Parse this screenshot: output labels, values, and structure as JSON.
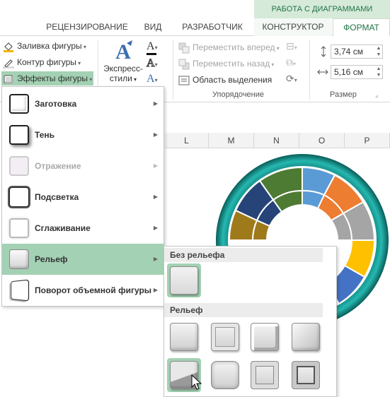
{
  "ribbon": {
    "context_group": "РАБОТА С ДИАГРАММАМИ",
    "tabs": [
      "РЕЦЕНЗИРОВАНИЕ",
      "ВИД",
      "РАЗРАБОТЧИК",
      "КОНСТРУКТОР",
      "ФОРМАТ"
    ],
    "active_tab": "ФОРМАТ",
    "shape_fill": "Заливка фигуры",
    "shape_outline": "Контур фигуры",
    "shape_effects": "Эффекты фигуры",
    "wordart_styles_line1": "Экспресс-",
    "wordart_styles_line2": "стили",
    "bring_forward": "Переместить вперед",
    "send_backward": "Переместить назад",
    "selection_pane": "Область выделения",
    "arrange_group": "Упорядочение",
    "height_value": "3,74 см",
    "width_value": "5,16 см",
    "size_group": "Размер"
  },
  "columns": [
    "L",
    "M",
    "N",
    "O",
    "P"
  ],
  "effects_menu": {
    "items": [
      {
        "label": "Заготовка",
        "disabled": false
      },
      {
        "label": "Тень",
        "disabled": false
      },
      {
        "label": "Отражение",
        "disabled": true
      },
      {
        "label": "Подсветка",
        "disabled": false
      },
      {
        "label": "Сглаживание",
        "disabled": false
      },
      {
        "label": "Рельеф",
        "disabled": false,
        "hover": true
      },
      {
        "label": "Поворот объемной фигуры",
        "disabled": false
      }
    ]
  },
  "bevel_menu": {
    "no_bevel_heading": "Без рельефа",
    "bevel_heading": "Рельеф"
  },
  "colors": {
    "accent": "#217346",
    "hover": "#a3d1b3",
    "ring_teal": "#1ea7a0"
  }
}
